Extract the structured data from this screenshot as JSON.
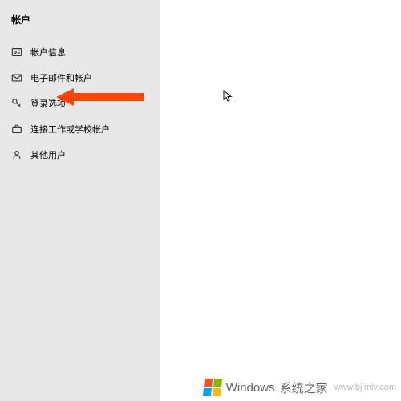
{
  "sidebar": {
    "title": "帐户",
    "items": [
      {
        "label": "帐户信息",
        "icon": "id-icon"
      },
      {
        "label": "电子邮件和帐户",
        "icon": "mail-icon"
      },
      {
        "label": "登录选项",
        "icon": "key-icon"
      },
      {
        "label": "连接工作或学校帐户",
        "icon": "briefcase-icon"
      },
      {
        "label": "其他用户",
        "icon": "person-icon"
      }
    ]
  },
  "watermark": {
    "brand": "Windows",
    "subtitle": "系统之家",
    "url": "www.bjjmlv.com"
  }
}
